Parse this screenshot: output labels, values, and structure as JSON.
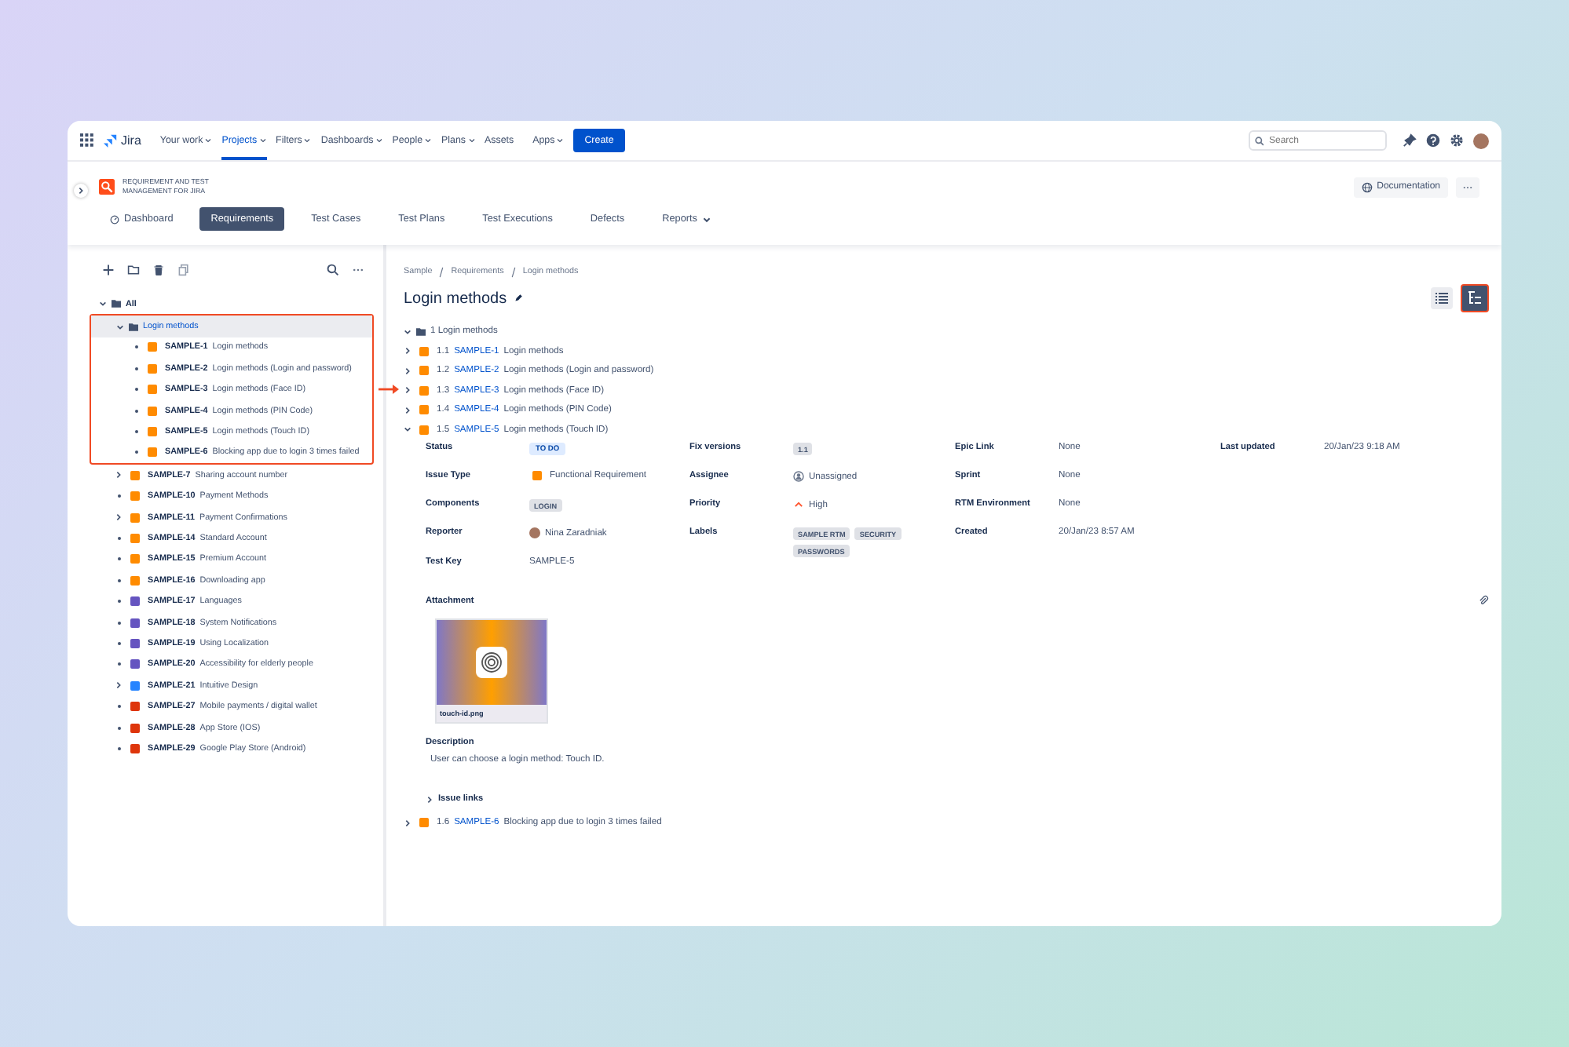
{
  "topnav": {
    "app_name": "Jira",
    "menus": [
      {
        "label": "Your work",
        "dropdown": true,
        "selected": false
      },
      {
        "label": "Projects",
        "dropdown": true,
        "selected": true
      },
      {
        "label": "Filters",
        "dropdown": true,
        "selected": false
      },
      {
        "label": "Dashboards",
        "dropdown": true,
        "selected": false
      },
      {
        "label": "People",
        "dropdown": true,
        "selected": false
      },
      {
        "label": "Plans",
        "dropdown": true,
        "selected": false
      },
      {
        "label": "Assets",
        "dropdown": false,
        "selected": false
      },
      {
        "label": "Apps",
        "dropdown": true,
        "selected": false
      }
    ],
    "create": "Create",
    "search": {
      "placeholder": "Search"
    }
  },
  "app_header": {
    "title": "REQUIREMENT AND TEST MANAGEMENT FOR JIRA",
    "documentation": "Documentation"
  },
  "tabs": [
    {
      "label": "Dashboard",
      "selected": false,
      "dropdown": false
    },
    {
      "label": "Requirements",
      "selected": true,
      "dropdown": false
    },
    {
      "label": "Test Cases",
      "selected": false,
      "dropdown": false
    },
    {
      "label": "Test Plans",
      "selected": false,
      "dropdown": false
    },
    {
      "label": "Test Executions",
      "selected": false,
      "dropdown": false
    },
    {
      "label": "Defects",
      "selected": false,
      "dropdown": false
    },
    {
      "label": "Reports",
      "selected": false,
      "dropdown": true
    }
  ],
  "tree": {
    "label": "All",
    "expanded": true,
    "children": [
      {
        "kind": "folder",
        "label": "Login methods",
        "expanded": true,
        "selected": true,
        "highlighted": true,
        "children": [
          {
            "key": "SAMPLE-1",
            "title": "Login methods",
            "color": "#ff8b00",
            "expandable": false
          },
          {
            "key": "SAMPLE-2",
            "title": "Login methods (Login and password)",
            "color": "#ff8b00",
            "expandable": false
          },
          {
            "key": "SAMPLE-3",
            "title": "Login methods (Face ID)",
            "color": "#ff8b00",
            "expandable": false
          },
          {
            "key": "SAMPLE-4",
            "title": "Login methods (PIN Code)",
            "color": "#ff8b00",
            "expandable": false
          },
          {
            "key": "SAMPLE-5",
            "title": "Login methods (Touch ID)",
            "color": "#ff8b00",
            "expandable": false
          },
          {
            "key": "SAMPLE-6",
            "title": "Blocking app due to login 3 times failed",
            "color": "#ff8b00",
            "expandable": false
          }
        ]
      },
      {
        "kind": "issue",
        "key": "SAMPLE-7",
        "title": "Sharing account number",
        "color": "#ff8b00",
        "expandable": true
      },
      {
        "kind": "issue",
        "key": "SAMPLE-10",
        "title": "Payment Methods",
        "color": "#ff8b00",
        "expandable": false
      },
      {
        "kind": "issue",
        "key": "SAMPLE-11",
        "title": "Payment Confirmations",
        "color": "#ff8b00",
        "expandable": true
      },
      {
        "kind": "issue",
        "key": "SAMPLE-14",
        "title": "Standard Account",
        "color": "#ff8b00",
        "expandable": false
      },
      {
        "kind": "issue",
        "key": "SAMPLE-15",
        "title": "Premium Account",
        "color": "#ff8b00",
        "expandable": false
      },
      {
        "kind": "issue",
        "key": "SAMPLE-16",
        "title": "Downloading app",
        "color": "#ff8b00",
        "expandable": false
      },
      {
        "kind": "issue",
        "key": "SAMPLE-17",
        "title": "Languages",
        "color": "#6554c0",
        "expandable": false
      },
      {
        "kind": "issue",
        "key": "SAMPLE-18",
        "title": "System Notifications",
        "color": "#6554c0",
        "expandable": false
      },
      {
        "kind": "issue",
        "key": "SAMPLE-19",
        "title": "Using Localization",
        "color": "#6554c0",
        "expandable": false
      },
      {
        "kind": "issue",
        "key": "SAMPLE-20",
        "title": "Accessibility for elderly people",
        "color": "#6554c0",
        "expandable": false
      },
      {
        "kind": "issue",
        "key": "SAMPLE-21",
        "title": "Intuitive Design",
        "color": "#2684ff",
        "expandable": true
      },
      {
        "kind": "issue",
        "key": "SAMPLE-27",
        "title": "Mobile payments / digital wallet",
        "color": "#de350b",
        "expandable": false
      },
      {
        "kind": "issue",
        "key": "SAMPLE-28",
        "title": "App Store (IOS)",
        "color": "#de350b",
        "expandable": false
      },
      {
        "kind": "issue",
        "key": "SAMPLE-29",
        "title": "Google Play Store (Android)",
        "color": "#de350b",
        "expandable": false
      }
    ]
  },
  "breadcrumbs": [
    "Sample",
    "Requirements",
    "Login methods"
  ],
  "page_title": "Login methods",
  "view_toggle": [
    {
      "kind": "list",
      "selected": false,
      "highlighted": false
    },
    {
      "kind": "tree",
      "selected": true,
      "highlighted": true
    }
  ],
  "outline": {
    "heading": "1 Login methods",
    "expanded": true,
    "items": [
      {
        "number": "1.1",
        "key": "SAMPLE-1",
        "title": "Login methods",
        "expanded": false
      },
      {
        "number": "1.2",
        "key": "SAMPLE-2",
        "title": "Login methods (Login and password)",
        "expanded": false
      },
      {
        "number": "1.3",
        "key": "SAMPLE-3",
        "title": "Login methods (Face ID)",
        "expanded": false
      },
      {
        "number": "1.4",
        "key": "SAMPLE-4",
        "title": "Login methods (PIN Code)",
        "expanded": false
      },
      {
        "number": "1.5",
        "key": "SAMPLE-5",
        "title": "Login methods (Touch ID)",
        "expanded": true,
        "details": {
          "field_rows": [
            [
              {
                "label": "Status",
                "kind": "lozenge",
                "value": "TO DO"
              },
              {
                "label": "Fix versions",
                "kind": "tags",
                "values": [
                  "1.1"
                ]
              },
              {
                "label": "Epic Link",
                "kind": "text",
                "value": "None"
              },
              {
                "label": "Last updated",
                "kind": "text",
                "value": "20/Jan/23 9:18 AM"
              }
            ],
            [
              {
                "label": "Issue Type",
                "kind": "issue_type",
                "value": "Functional Requirement"
              },
              {
                "label": "Assignee",
                "kind": "unassigned",
                "value": "Unassigned"
              },
              {
                "label": "Sprint",
                "kind": "text",
                "value": "None"
              }
            ],
            [
              {
                "label": "Components",
                "kind": "tags",
                "values": [
                  "LOGIN"
                ]
              },
              {
                "label": "Priority",
                "kind": "priority",
                "value": "High"
              },
              {
                "label": "RTM Environment",
                "kind": "text",
                "value": "None"
              }
            ],
            [
              {
                "label": "Reporter",
                "kind": "user",
                "value": "Nina Zaradniak"
              },
              {
                "label": "Labels",
                "kind": "tags",
                "values": [
                  "SAMPLE RTM",
                  "SECURITY",
                  "PASSWORDS"
                ]
              },
              {
                "label": "Created",
                "kind": "text",
                "value": "20/Jan/23 8:57 AM"
              }
            ],
            [
              {
                "label": "Test Key",
                "kind": "text",
                "value": "SAMPLE-5"
              }
            ]
          ],
          "attachment": {
            "heading": "Attachment",
            "filename": "touch-id.png"
          },
          "description": {
            "heading": "Description",
            "text": "User can choose a login method: Touch ID."
          },
          "issue_links": {
            "label": "Issue links",
            "expanded": false
          }
        }
      },
      {
        "number": "1.6",
        "key": "SAMPLE-6",
        "title": "Blocking app due to login 3 times failed",
        "expanded": false
      }
    ]
  }
}
